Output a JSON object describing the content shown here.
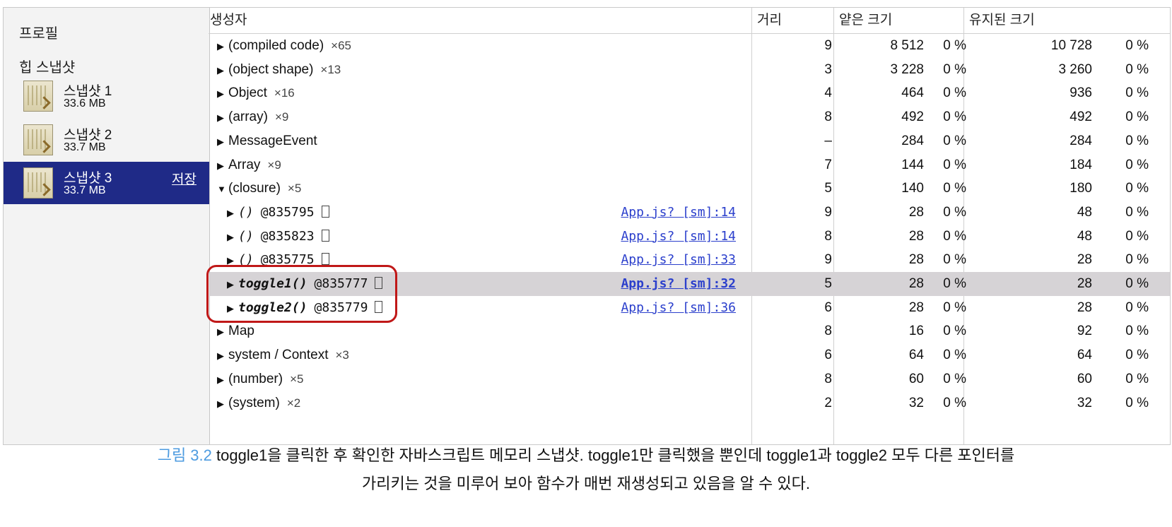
{
  "sidebar": {
    "profiles_title": "프로필",
    "heap_title": "힙 스냅샷",
    "snapshots": [
      {
        "name": "스냅샷 1",
        "size": "33.6 MB"
      },
      {
        "name": "스냅샷 2",
        "size": "33.7 MB"
      },
      {
        "name": "스냅샷 3",
        "size": "33.7 MB",
        "action": "저장"
      }
    ]
  },
  "table": {
    "headers": {
      "constructor": "생성자",
      "distance": "거리",
      "shallow": "얕은 크기",
      "retained": "유지된 크기"
    },
    "rows": [
      {
        "name": "(compiled code)",
        "count": "×65",
        "dist": "9",
        "shallow": "8 512",
        "shallow_pct": "0 %",
        "retained": "10 728",
        "retained_pct": "0 %"
      },
      {
        "name": "(object shape)",
        "count": "×13",
        "dist": "3",
        "shallow": "3 228",
        "shallow_pct": "0 %",
        "retained": "3 260",
        "retained_pct": "0 %"
      },
      {
        "name": "Object",
        "count": "×16",
        "dist": "4",
        "shallow": "464",
        "shallow_pct": "0 %",
        "retained": "936",
        "retained_pct": "0 %"
      },
      {
        "name": "(array)",
        "count": "×9",
        "dist": "8",
        "shallow": "492",
        "shallow_pct": "0 %",
        "retained": "492",
        "retained_pct": "0 %"
      },
      {
        "name": "MessageEvent",
        "count": "",
        "dist": "–",
        "shallow": "284",
        "shallow_pct": "0 %",
        "retained": "284",
        "retained_pct": "0 %"
      },
      {
        "name": "Array",
        "count": "×9",
        "dist": "7",
        "shallow": "144",
        "shallow_pct": "0 %",
        "retained": "184",
        "retained_pct": "0 %"
      },
      {
        "name": "(closure)",
        "count": "×5",
        "dist": "5",
        "shallow": "140",
        "shallow_pct": "0 %",
        "retained": "180",
        "retained_pct": "0 %"
      },
      {
        "fn": "()",
        "id": "@835795",
        "src": "App.js? [sm]:14",
        "dist": "9",
        "shallow": "28",
        "shallow_pct": "0 %",
        "retained": "48",
        "retained_pct": "0 %"
      },
      {
        "fn": "()",
        "id": "@835823",
        "src": "App.js? [sm]:14",
        "dist": "8",
        "shallow": "28",
        "shallow_pct": "0 %",
        "retained": "48",
        "retained_pct": "0 %"
      },
      {
        "fn": "()",
        "id": "@835775",
        "src": "App.js? [sm]:33",
        "dist": "9",
        "shallow": "28",
        "shallow_pct": "0 %",
        "retained": "28",
        "retained_pct": "0 %"
      },
      {
        "fn": "toggle1()",
        "id": "@835777",
        "src": "App.js? [sm]:32",
        "dist": "5",
        "shallow": "28",
        "shallow_pct": "0 %",
        "retained": "28",
        "retained_pct": "0 %"
      },
      {
        "fn": "toggle2()",
        "id": "@835779",
        "src": "App.js? [sm]:36",
        "dist": "6",
        "shallow": "28",
        "shallow_pct": "0 %",
        "retained": "28",
        "retained_pct": "0 %"
      },
      {
        "name": "Map",
        "count": "",
        "dist": "8",
        "shallow": "16",
        "shallow_pct": "0 %",
        "retained": "92",
        "retained_pct": "0 %"
      },
      {
        "name": "system / Context",
        "count": "×3",
        "dist": "6",
        "shallow": "64",
        "shallow_pct": "0 %",
        "retained": "64",
        "retained_pct": "0 %"
      },
      {
        "name": "(number)",
        "count": "×5",
        "dist": "8",
        "shallow": "60",
        "shallow_pct": "0 %",
        "retained": "60",
        "retained_pct": "0 %"
      },
      {
        "name": "(system)",
        "count": "×2",
        "dist": "2",
        "shallow": "32",
        "shallow_pct": "0 %",
        "retained": "32",
        "retained_pct": "0 %"
      }
    ]
  },
  "caption": {
    "figure": "그림 3.2",
    "line1": "toggle1을 클릭한 후 확인한 자바스크립트 메모리 스냅샷. toggle1만 클릭했을 뿐인데 toggle1과 toggle2 모두 다른 포인터를",
    "line2": "가리키는 것을 미루어 보아 함수가 매번 재생성되고 있음을 알 수 있다."
  }
}
